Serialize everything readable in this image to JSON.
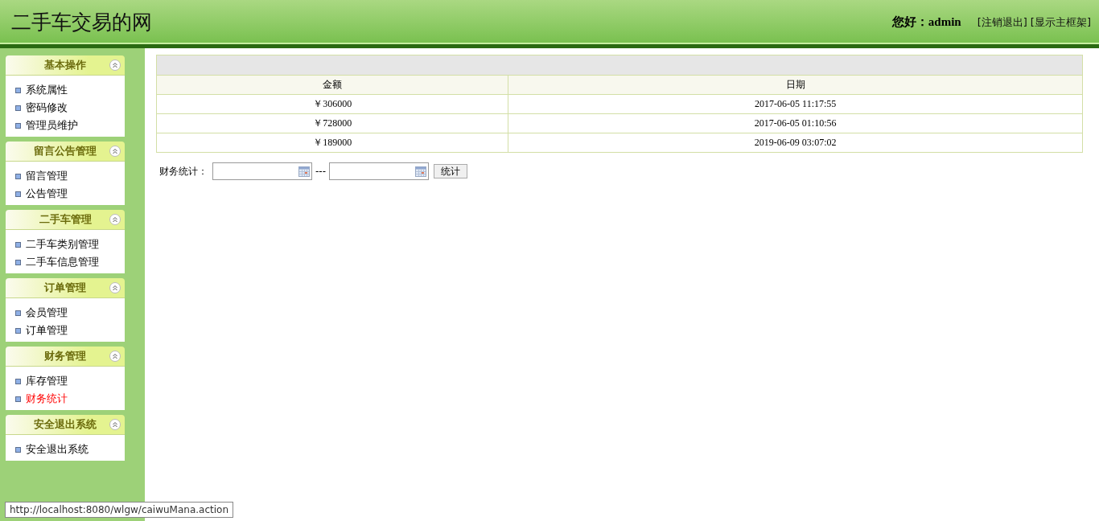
{
  "header": {
    "title": "二手车交易的网",
    "greeting": "您好：admin",
    "links": [
      "[注销退出]",
      "[显示主框架]"
    ]
  },
  "sidebar": {
    "sections": [
      {
        "title": "基本操作",
        "items": [
          {
            "label": "系统属性",
            "selected": false
          },
          {
            "label": "密码修改",
            "selected": false
          },
          {
            "label": "管理员维护",
            "selected": false
          }
        ]
      },
      {
        "title": "留言公告管理",
        "items": [
          {
            "label": "留言管理",
            "selected": false
          },
          {
            "label": "公告管理",
            "selected": false
          }
        ]
      },
      {
        "title": "二手车管理",
        "items": [
          {
            "label": "二手车类别管理",
            "selected": false
          },
          {
            "label": "二手车信息管理",
            "selected": false
          }
        ]
      },
      {
        "title": "订单管理",
        "items": [
          {
            "label": "会员管理",
            "selected": false
          },
          {
            "label": "订单管理",
            "selected": false
          }
        ]
      },
      {
        "title": "财务管理",
        "items": [
          {
            "label": "库存管理",
            "selected": false
          },
          {
            "label": "财务统计",
            "selected": true
          }
        ]
      },
      {
        "title": "安全退出系统",
        "items": [
          {
            "label": "安全退出系统",
            "selected": false
          }
        ]
      }
    ]
  },
  "table": {
    "columns": [
      "金额",
      "日期"
    ],
    "rows": [
      [
        "￥306000",
        "2017-06-05 11:17:55"
      ],
      [
        "￥728000",
        "2017-06-05 01:10:56"
      ],
      [
        "￥189000",
        "2019-06-09 03:07:02"
      ]
    ]
  },
  "filter": {
    "label": "财务统计：",
    "separator": "---",
    "button": "统计"
  },
  "status_bar": "http://localhost:8080/wlgw/caiwuMana.action"
}
